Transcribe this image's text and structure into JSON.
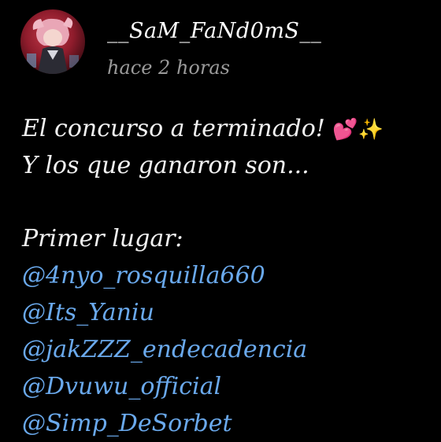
{
  "post": {
    "author": {
      "username": "__SaM_FaNd0mS__",
      "timestamp": "hace 2 horas"
    },
    "text_line_1": "El concurso a terminado!",
    "text_line_2": "Y los que ganaron son...",
    "emojis": {
      "heart": "💕",
      "sparkles": "✨"
    },
    "section_title": "Primer lugar:",
    "mentions": [
      "@4nyo_rosquilla660",
      "@Its_Yaniu",
      "@jakZZZ_endecadencia",
      "@Dvuwu_official",
      "@Simp_DeSorbet"
    ]
  }
}
